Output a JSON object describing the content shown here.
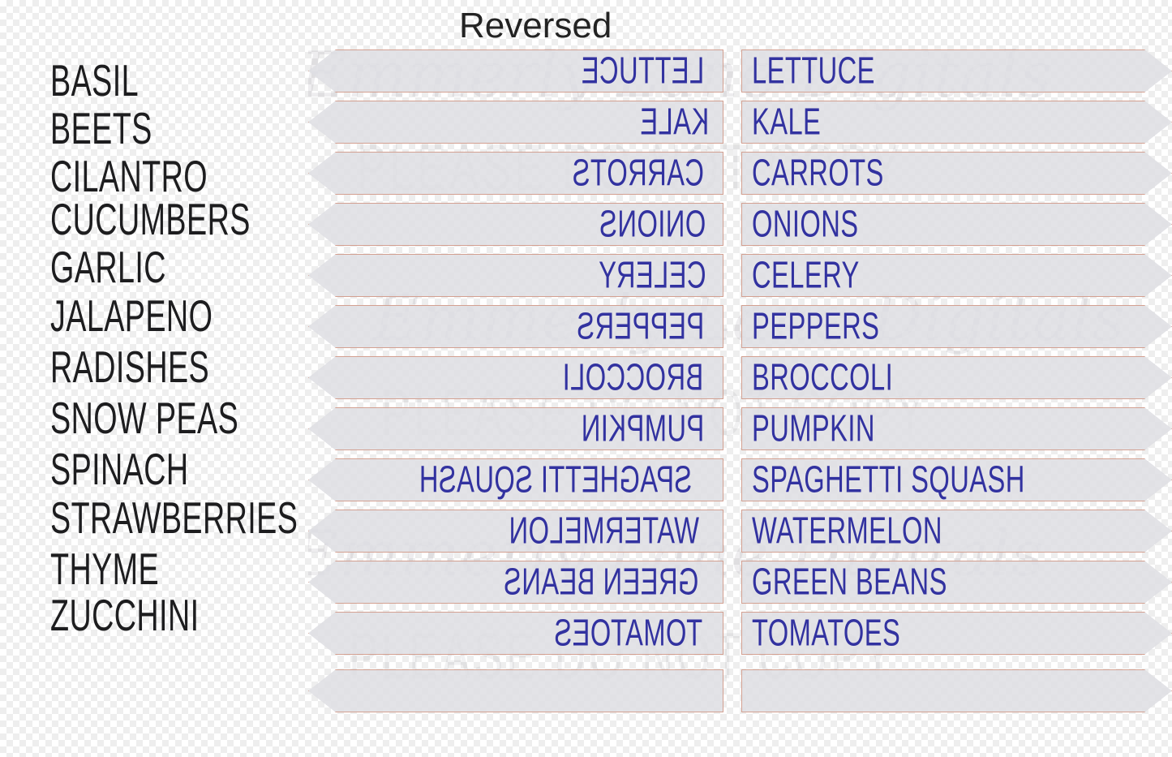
{
  "title": "Reversed",
  "colors": {
    "text_navy": "#3232a0",
    "stake_outline": "#d3a091",
    "stake_fill": "#dedee3",
    "list_text": "#1d1d1f",
    "title_text": "#232323",
    "watermark": "#787680"
  },
  "left_list": {
    "heading": "",
    "items": [
      "BASIL",
      "BEETS",
      "CILANTRO",
      "CUCUMBERS",
      "GARLIC",
      "JALAPENO",
      "RADISHES",
      "SNOW PEAS",
      "SPINACH",
      "STRAWBERRIES",
      "THYME",
      "ZUCCHINI"
    ]
  },
  "stake_rows": [
    {
      "reversed_label": "LETTUCE",
      "normal_label": "LETTUCE"
    },
    {
      "reversed_label": "KALE",
      "normal_label": "KALE"
    },
    {
      "reversed_label": "CARROTS",
      "normal_label": "CARROTS"
    },
    {
      "reversed_label": "ONIONS",
      "normal_label": "ONIONS"
    },
    {
      "reversed_label": "CELERY",
      "normal_label": "CELERY"
    },
    {
      "reversed_label": "PEPPERS",
      "normal_label": "PEPPERS"
    },
    {
      "reversed_label": "BROCCOLI",
      "normal_label": "BROCCOLI"
    },
    {
      "reversed_label": "PUMPKIN",
      "normal_label": "PUMPKIN"
    },
    {
      "reversed_label": "SPAGHETTI SQUASH",
      "normal_label": "SPAGHETTI SQUASH"
    },
    {
      "reversed_label": "WATERMELON",
      "normal_label": "WATERMELON"
    },
    {
      "reversed_label": "GREEN BEANS",
      "normal_label": "GREEN BEANS"
    },
    {
      "reversed_label": "TOMATOES",
      "normal_label": "TOMATOES"
    },
    {
      "reversed_label": "",
      "normal_label": ""
    }
  ],
  "watermark": {
    "script_text": "Emmerly Lane Digitals",
    "block_text": "PLEASE DO NOT COPY"
  }
}
